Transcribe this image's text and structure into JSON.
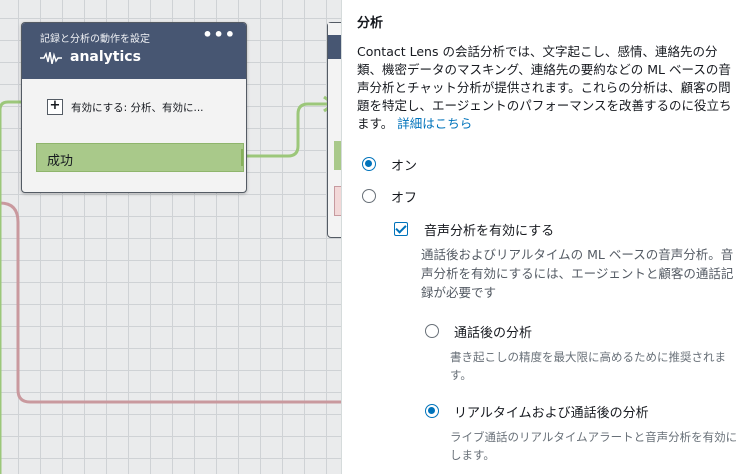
{
  "flow_block": {
    "type_label": "記録と分析の動作を設定",
    "menu": "•••",
    "title": "analytics",
    "description": "有効にする: 分析、有効に...",
    "expand_symbol": "+",
    "success_label": "成功"
  },
  "panel": {
    "title": "分析",
    "description": "Contact Lens の会話分析では、文字起こし、感情、連絡先の分類、機密データのマスキング、連絡先の要約などの ML ベースの音声分析とチャット分析が提供されます。これらの分析は、顧客の問題を特定し、エージェントのパフォーマンスを改善するのに役立ちます。",
    "learn_more": "詳細はこちら",
    "options": {
      "on_label": "オン",
      "off_label": "オフ",
      "selected": "on"
    },
    "voice_analytics": {
      "label": "音声分析を有効にする",
      "checked": true,
      "help": "通話後およびリアルタイムの ML ベースの音声分析。音声分析を有効にするには、エージェントと顧客の通話記録が必要です",
      "post_call": {
        "label": "通話後の分析",
        "help": "書き起こしの精度を最大限に高めるために推奨されます。",
        "selected": false
      },
      "realtime": {
        "label": "リアルタイムおよび通話後の分析",
        "help": "ライブ通話のリアルタイムアラートと音声分析を有効にします。",
        "selected": true
      }
    }
  }
}
